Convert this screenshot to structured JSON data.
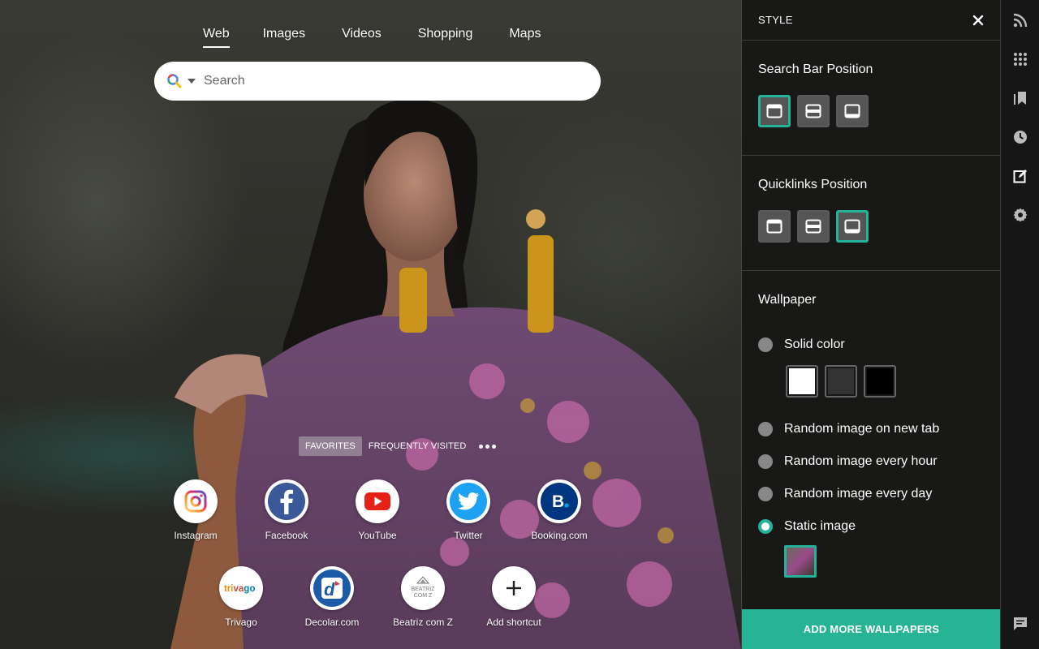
{
  "search": {
    "tabs": [
      "Web",
      "Images",
      "Videos",
      "Shopping",
      "Maps"
    ],
    "active_tab": "Web",
    "placeholder": "Search"
  },
  "quicklinks": {
    "tabs": [
      "Favorites",
      "Frequently Visited"
    ],
    "active_tab": "Favorites",
    "items": [
      {
        "label": "Instagram",
        "icon": "instagram-icon"
      },
      {
        "label": "Facebook",
        "icon": "facebook-icon"
      },
      {
        "label": "YouTube",
        "icon": "youtube-icon"
      },
      {
        "label": "Twitter",
        "icon": "twitter-icon"
      },
      {
        "label": "Booking.com",
        "icon": "booking-icon",
        "glyph": "B."
      },
      {
        "label": "Trivago",
        "icon": "trivago-icon",
        "glyph": "trivago"
      },
      {
        "label": "Decolar.com",
        "icon": "decolar-icon",
        "glyph": "d"
      },
      {
        "label": "Beatriz com Z",
        "icon": "beatriz-icon",
        "glyph": "BEATRIZ\nCOM Z"
      },
      {
        "label": "Add shortcut",
        "icon": "plus-icon"
      }
    ]
  },
  "panel": {
    "title": "STYLE",
    "search_bar_position": {
      "title": "Search Bar Position",
      "selected": "top"
    },
    "quicklinks_position": {
      "title": "Quicklinks Position",
      "selected": "bottom"
    },
    "wallpaper": {
      "title": "Wallpaper",
      "options": [
        "Solid color",
        "Random image on new tab",
        "Random image every hour",
        "Random image every day",
        "Static image"
      ],
      "selected": "Static image",
      "swatches": [
        "#ffffff",
        "#333333",
        "#000000"
      ]
    },
    "add_button": "Add more wallpapers"
  },
  "rail": {
    "icons": [
      "rss-icon",
      "apps-grid-icon",
      "bookmarks-icon",
      "history-icon",
      "edit-style-icon",
      "settings-icon",
      "feedback-icon"
    ]
  },
  "colors": {
    "accent": "#26b494"
  }
}
